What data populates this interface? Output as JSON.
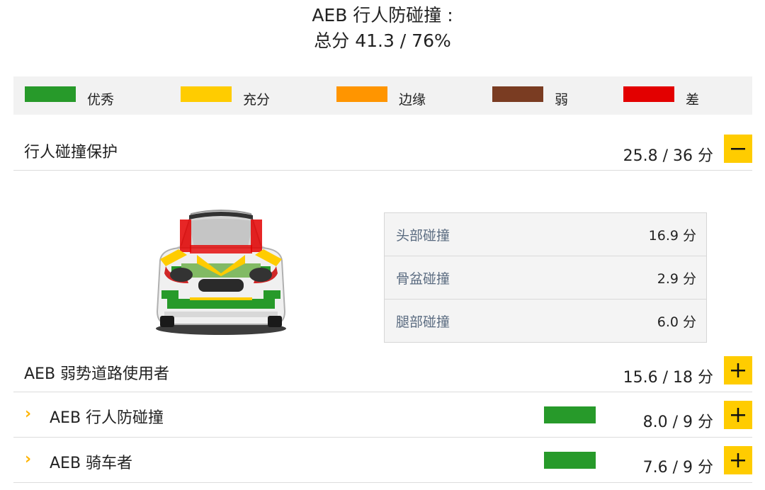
{
  "header": {
    "title_line1": "AEB 行人防碰撞 :",
    "title_line2": "总分 41.3 / 76%"
  },
  "legend": [
    {
      "label": "优秀",
      "color": "#279a2a"
    },
    {
      "label": "充分",
      "color": "#ffcc00"
    },
    {
      "label": "边缘",
      "color": "#ff9500"
    },
    {
      "label": "弱",
      "color": "#7a3c22"
    },
    {
      "label": "差",
      "color": "#e30000"
    }
  ],
  "sections": {
    "pedestrian_protection": {
      "label": "行人碰撞保护",
      "score": "25.8 / 36 分",
      "expanded": true,
      "details": [
        {
          "label": "头部碰撞",
          "value": "16.9 分"
        },
        {
          "label": "骨盆碰撞",
          "value": "2.9 分"
        },
        {
          "label": "腿部碰撞",
          "value": "6.0 分"
        }
      ]
    },
    "vru": {
      "label": "AEB 弱势道路使用者",
      "score": "15.6 / 18 分",
      "expanded": false
    },
    "aeb_pedestrian": {
      "label": "AEB 行人防碰撞",
      "score": "8.0 / 9 分",
      "rating_color": "#279a2a"
    },
    "aeb_cyclist": {
      "label": "AEB 骑车者",
      "score": "7.6 / 9 分",
      "rating_color": "#279a2a"
    }
  },
  "icons": {
    "collapse": "minus-icon",
    "expand": "plus-icon",
    "chevron": "chevron-right-icon"
  }
}
